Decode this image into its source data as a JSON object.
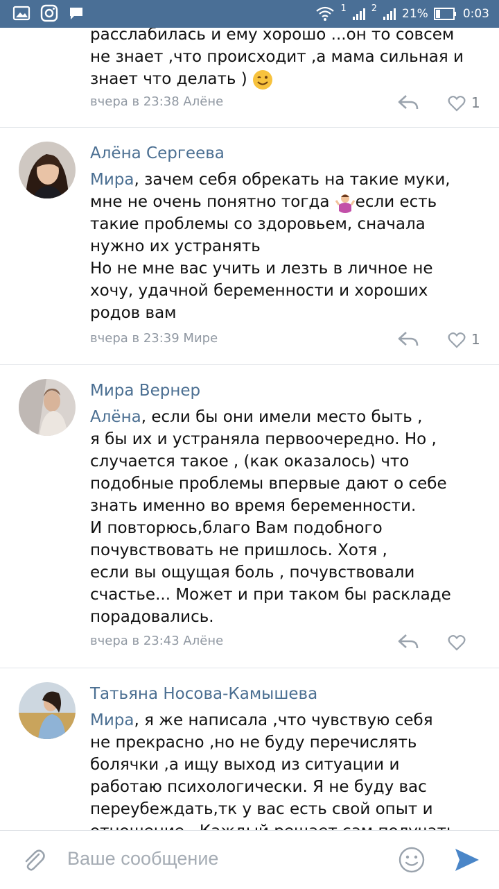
{
  "status_bar": {
    "sim1": "1",
    "sim2": "2",
    "battery": "21%",
    "time": "0:03",
    "icons": [
      "gallery-icon",
      "instagram-icon",
      "chat-icon",
      "wifi-icon",
      "signal-icon",
      "battery-icon"
    ]
  },
  "comments": [
    {
      "author": "",
      "lines": [
        "расслабилась и ему хорошо ...он то совсем",
        "не знает ,что происходит ,а мама сильная и",
        "знает что делать )"
      ],
      "meta": "вчера в 23:38 Алёне",
      "likes": "1"
    },
    {
      "author": "Алёна Сергеева",
      "mention": "Мира",
      "lines": [
        ", зачем себя обрекать на такие муки,",
        "мне не очень понятно тогда ",
        "если есть",
        "такие проблемы со здоровьем, сначала",
        "нужно их устранять",
        "Но не мне вас учить и лезть в личное не",
        "хочу, удачной беременности и хороших",
        "родов вам"
      ],
      "meta": "вчера в 23:39 Мире",
      "likes": "1"
    },
    {
      "author": "Мира Вернер",
      "mention": "Алёна",
      "lines": [
        ", если бы они имели место быть ,",
        "я бы их и устраняла первоочередно. Но ,",
        "случается такое , (как оказалось) что",
        "подобные проблемы впервые дают о себе",
        "знать именно во время беременности.",
        "И повторюсь,благо Вам подобного",
        "почувствовать не пришлось. Хотя ,",
        "если вы ощущая боль , почувствовали",
        "счастье... Может и при таком  бы раскладе",
        "порадовались."
      ],
      "meta": "вчера в 23:43 Алёне",
      "likes": ""
    },
    {
      "author": "Татьяна Носова-Камышева",
      "mention": "Мира",
      "lines": [
        ", я же написала ,что чувствую себя",
        "не прекрасно ,но не буду перечислять",
        "болячки ,а ищу выход из ситуации и",
        "работаю психологически. Я не буду вас",
        "переубеждать,тк у вас есть свой опыт и",
        "отношение . Каждый решает сам получать"
      ]
    }
  ],
  "composer": {
    "placeholder": "Ваше сообщение",
    "icons": [
      "attach-icon",
      "emoji-icon",
      "send-icon"
    ]
  },
  "colors": {
    "status_bar": "#4a6f96",
    "link": "#4b6f92",
    "meta": "#9098a2",
    "send": "#4a86c8"
  }
}
